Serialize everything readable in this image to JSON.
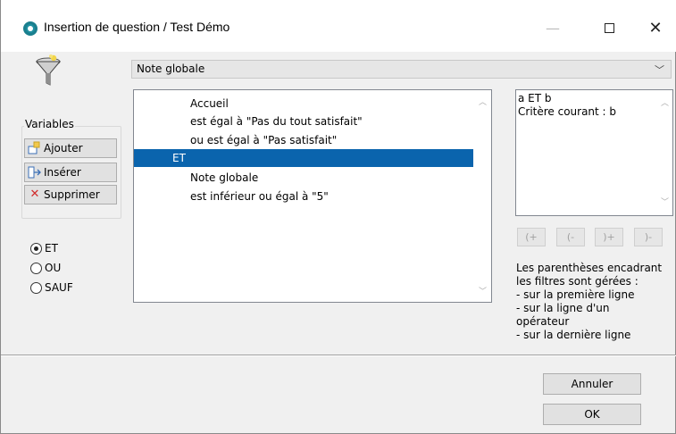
{
  "window": {
    "title": "Insertion de question / Test Démo",
    "minimize": "—",
    "close": "✕"
  },
  "question_select": {
    "value": "Note globale"
  },
  "variables": {
    "label": "Variables",
    "add": "Ajouter",
    "insert": "Insérer",
    "delete": "Supprimer"
  },
  "operators": [
    {
      "label": "ET",
      "checked": true
    },
    {
      "label": "OU",
      "checked": false
    },
    {
      "label": "SAUF",
      "checked": false
    }
  ],
  "criteria": [
    {
      "text": "Accueil",
      "selected": false
    },
    {
      "text": "est égal à \"Pas du tout satisfait\"",
      "selected": false
    },
    {
      "text": "ou est égal à \"Pas satisfait\"",
      "selected": false
    },
    {
      "text": "ET",
      "selected": true
    },
    {
      "text": "Note globale",
      "selected": false
    },
    {
      "text": "est inférieur ou égal à \"5\"",
      "selected": false
    }
  ],
  "formula": {
    "line1": "a ET b",
    "line2": "Critère courant : b"
  },
  "paren_buttons": [
    "(+",
    "(-",
    ")+",
    ")-"
  ],
  "help": {
    "l1": "Les parenthèses encadrant",
    "l2": "les filtres sont gérées :",
    "l3": "- sur la première ligne",
    "l4": "- sur la ligne d'un",
    "l5": "opérateur",
    "l6": "- sur la dernière ligne"
  },
  "dialog_buttons": {
    "cancel": "Annuler",
    "ok": "OK"
  },
  "colors": {
    "selection": "#0a64ad",
    "accent_icon": "#1f8fa0"
  }
}
